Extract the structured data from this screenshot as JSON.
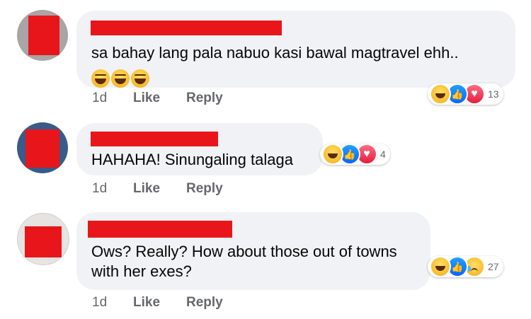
{
  "comments": [
    {
      "text": "sa bahay lang pala nabuo kasi bawal magtravel ehh..",
      "emoji_count": 3,
      "time": "1d",
      "like_label": "Like",
      "reply_label": "Reply",
      "reaction_icons": [
        "haha",
        "like",
        "love"
      ],
      "reaction_count": "13"
    },
    {
      "text": "HAHAHA! Sinungaling talaga",
      "time": "1d",
      "like_label": "Like",
      "reply_label": "Reply",
      "reaction_icons": [
        "haha",
        "like",
        "love"
      ],
      "reaction_count": "4"
    },
    {
      "text_line1": "Ows? Really? How about those out of towns",
      "text_line2": "with her exes?",
      "time": "1d",
      "like_label": "Like",
      "reply_label": "Reply",
      "reaction_icons": [
        "haha",
        "like",
        "sad"
      ],
      "reaction_count": "27"
    }
  ],
  "colors": {
    "bubble": "#f0f2f5",
    "redaction": "#e8161b",
    "meta_text": "#65676b"
  }
}
